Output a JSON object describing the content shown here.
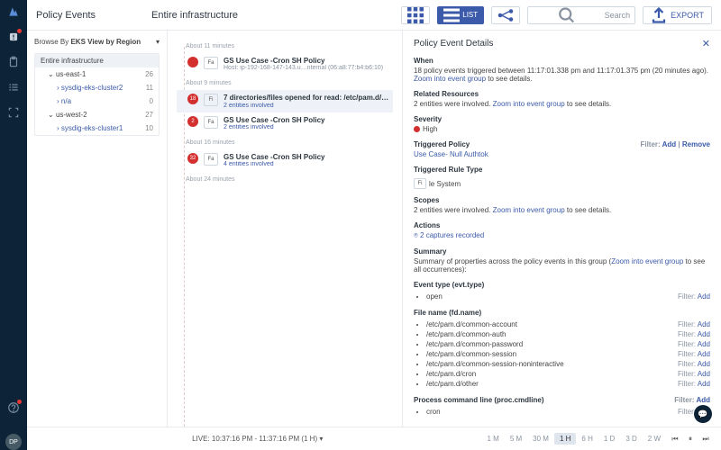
{
  "header": {
    "title": "Policy Events",
    "crumb": "Entire infrastructure",
    "search_placeholder": "Search",
    "export": "EXPORT",
    "list": "LIST"
  },
  "browse": {
    "label": "Browse By",
    "value": "EKS View by Region"
  },
  "tree": {
    "root": "Entire infrastructure",
    "nodes": [
      {
        "label": "us-east-1",
        "count": 26,
        "children": [
          {
            "label": "sysdig-eks-cluster2",
            "count": 11
          },
          {
            "label": "n/a",
            "count": 0
          }
        ]
      },
      {
        "label": "us-west-2",
        "count": 27,
        "children": [
          {
            "label": "sysdig-eks-cluster1",
            "count": 10
          }
        ]
      }
    ]
  },
  "timeline": [
    {
      "section": "About 11 minutes",
      "events": [
        {
          "count": "",
          "tag": "Fa",
          "title": "GS Use Case -Cron SH Policy",
          "sub": "Host: ip-192-168-147-143.u…nternal (06:a8:77:b4:b6:10)"
        }
      ]
    },
    {
      "section": "About 9 minutes",
      "events": [
        {
          "count": "18",
          "tag": "Fi",
          "title": "7 directories/files opened for read: /etc/pam.d/…",
          "sub": "2 entities involved",
          "selected": true,
          "capture": true
        },
        {
          "count": "2",
          "tag": "Fa",
          "title": "GS Use Case -Cron SH Policy",
          "sub": "2 entities involved",
          "link": true
        }
      ]
    },
    {
      "section": "About 16 minutes",
      "events": [
        {
          "count": "32",
          "tag": "Fa",
          "title": "GS Use Case -Cron SH Policy",
          "sub": "4 entities involved",
          "link": true
        }
      ]
    },
    {
      "section": "About 24 minutes",
      "events": []
    }
  ],
  "detail": {
    "title": "Policy Event Details",
    "when_label": "When",
    "when_text": "18 policy events triggered between 11:17:01.338 pm and 11:17:01.375 pm (20 minutes ago).",
    "zoom": "Zoom into event group",
    "see": " to see details.",
    "rr_label": "Related Resources",
    "rr_text": "2 entities were involved. ",
    "sev_label": "Severity",
    "sev_value": "High",
    "tp_label": "Triggered Policy",
    "tp_value": "Use Case- Null Authtok",
    "filter": "Filter:",
    "add": "Add",
    "remove": "Remove",
    "trt_label": "Triggered Rule Type",
    "trt_tag": "Fi",
    "trt_value": "le System",
    "scopes_label": "Scopes",
    "scopes_text": "2 entities were involved. ",
    "actions_label": "Actions",
    "actions_value": "2 captures recorded",
    "summary_label": "Summary",
    "summary_text": "Summary of properties across the policy events in this group (",
    "summary_tail": " to see all occurrences):",
    "evt_label": "Event type (evt.type)",
    "evt_items": [
      "open"
    ],
    "fd_label": "File name (fd.name)",
    "fd_items": [
      "/etc/pam.d/common-account",
      "/etc/pam.d/common-auth",
      "/etc/pam.d/common-password",
      "/etc/pam.d/common-session",
      "/etc/pam.d/common-session-noninteractive",
      "/etc/pam.d/cron",
      "/etc/pam.d/other"
    ],
    "proc_label": "Process command line (proc.cmdline)",
    "proc_items": [
      "cron"
    ]
  },
  "bottom": {
    "live": "LIVE: 10:37:16 PM - 11:37:16 PM (1 H)",
    "ranges": [
      "1 M",
      "5 M",
      "30 M",
      "1 H",
      "6 H",
      "1 D",
      "3 D",
      "2 W"
    ],
    "active": "1 H"
  },
  "avatar": "DP"
}
